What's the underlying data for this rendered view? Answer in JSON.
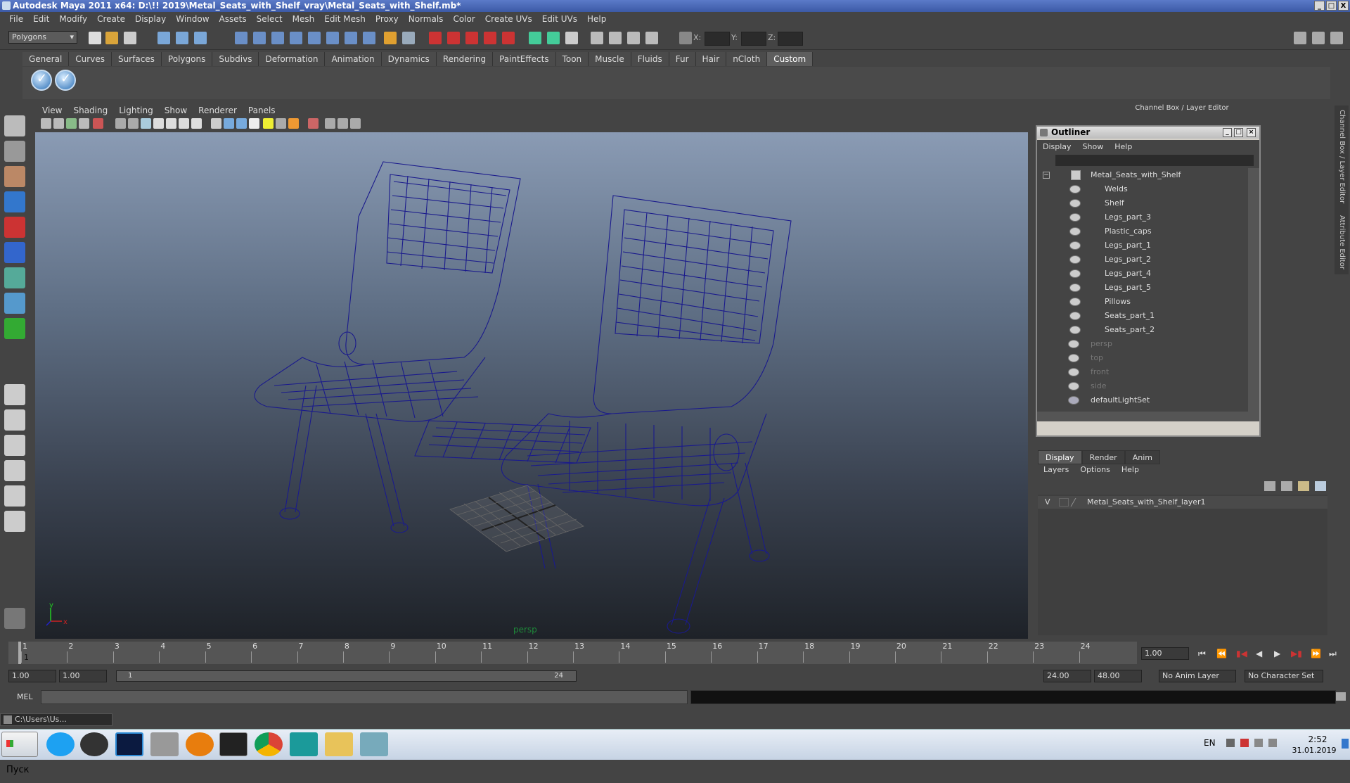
{
  "window": {
    "title": "Autodesk Maya 2011 x64: D:\\!! 2019\\Metal_Seats_with_Shelf_vray\\Metal_Seats_with_Shelf.mb*",
    "controls": [
      "_",
      "□",
      "X"
    ]
  },
  "menubar": [
    "File",
    "Edit",
    "Modify",
    "Create",
    "Display",
    "Window",
    "Assets",
    "Select",
    "Mesh",
    "Edit Mesh",
    "Proxy",
    "Normals",
    "Color",
    "Create UVs",
    "Edit UVs",
    "Help"
  ],
  "status_line": {
    "mode": "Polygons",
    "x_label": "X:",
    "y_label": "Y:",
    "z_label": "Z:"
  },
  "shelf": {
    "tabs": [
      "General",
      "Curves",
      "Surfaces",
      "Polygons",
      "Subdivs",
      "Deformation",
      "Animation",
      "Dynamics",
      "Rendering",
      "PaintEffects",
      "Toon",
      "Muscle",
      "Fluids",
      "Fur",
      "Hair",
      "nCloth",
      "Custom"
    ],
    "active_tab": "Custom"
  },
  "viewport": {
    "menu": [
      "View",
      "Shading",
      "Lighting",
      "Show",
      "Renderer",
      "Panels"
    ],
    "camera_label": "persp",
    "axis_y": "y",
    "axis_x": "x"
  },
  "channel_box": {
    "title": "Channel Box / Layer Editor",
    "side_tabs": [
      "Channel Box / Layer Editor",
      "Attribute Editor"
    ]
  },
  "outliner": {
    "title": "Outliner",
    "menu": [
      "Display",
      "Show",
      "Help"
    ],
    "items": [
      {
        "label": "Metal_Seats_with_Shelf",
        "type": "root"
      },
      {
        "label": "Welds",
        "type": "child"
      },
      {
        "label": "Shelf",
        "type": "child"
      },
      {
        "label": "Legs_part_3",
        "type": "child"
      },
      {
        "label": "Plastic_caps",
        "type": "child"
      },
      {
        "label": "Legs_part_1",
        "type": "child"
      },
      {
        "label": "Legs_part_2",
        "type": "child"
      },
      {
        "label": "Legs_part_4",
        "type": "child"
      },
      {
        "label": "Legs_part_5",
        "type": "child"
      },
      {
        "label": "Pillows",
        "type": "child"
      },
      {
        "label": "Seats_part_1",
        "type": "child"
      },
      {
        "label": "Seats_part_2",
        "type": "child"
      },
      {
        "label": "persp",
        "type": "camera"
      },
      {
        "label": "top",
        "type": "camera"
      },
      {
        "label": "front",
        "type": "camera"
      },
      {
        "label": "side",
        "type": "camera"
      },
      {
        "label": "defaultLightSet",
        "type": "set"
      }
    ]
  },
  "layer_editor": {
    "tabs": [
      "Display",
      "Render",
      "Anim"
    ],
    "active_tab": "Display",
    "menu": [
      "Layers",
      "Options",
      "Help"
    ],
    "layer": {
      "visible": "V",
      "name": "Metal_Seats_with_Shelf_layer1"
    }
  },
  "timeline": {
    "ticks": [
      "1",
      "2",
      "3",
      "4",
      "5",
      "6",
      "7",
      "8",
      "9",
      "10",
      "11",
      "12",
      "13",
      "14",
      "15",
      "16",
      "17",
      "18",
      "19",
      "20",
      "21",
      "22",
      "23",
      "24"
    ],
    "current_frame_field": "1.00",
    "current_frame_marker": "1"
  },
  "range_slider": {
    "start_field": "1.00",
    "start_inner": "1.00",
    "range_start": "1",
    "range_end": "24",
    "end_inner": "24.00",
    "end_field": "48.00",
    "anim_layer": "No Anim Layer",
    "character_set": "No Character Set"
  },
  "command_line": {
    "label": "MEL"
  },
  "taskbar": {
    "start": "Пуск",
    "cmd_window": "C:\\Users\\Us...",
    "lang": "EN",
    "time": "2:52",
    "date": "31.01.2019"
  },
  "colors": {
    "wireframe": "#1a1a8c",
    "titlebar": "#3c5aa6",
    "ui_bg": "#444444",
    "outliner_border": "#d4d0c8"
  }
}
